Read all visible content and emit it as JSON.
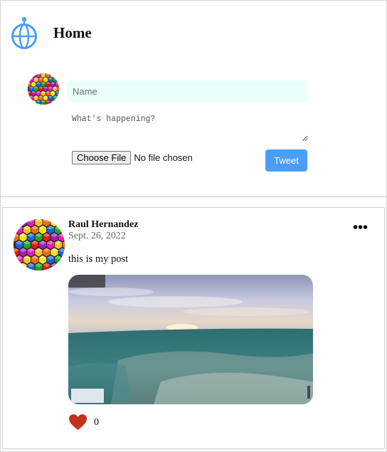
{
  "header": {
    "title": "Home",
    "logo_icon": "globe-icon"
  },
  "composer": {
    "name_placeholder": "Name",
    "content_placeholder": "What's happening?",
    "file_button_label": "Choose File",
    "file_status": "No file chosen",
    "submit_label": "Tweet"
  },
  "post": {
    "author": "Raul Hernandez",
    "date": "Sept. 26, 2022",
    "text": "this is my post",
    "likes": "0",
    "menu_icon": "more-horizontal-icon",
    "like_icon": "heart-icon"
  },
  "colors": {
    "accent": "#4a9ef8",
    "input_background": "#ecfef9",
    "like": "#c0341d"
  }
}
